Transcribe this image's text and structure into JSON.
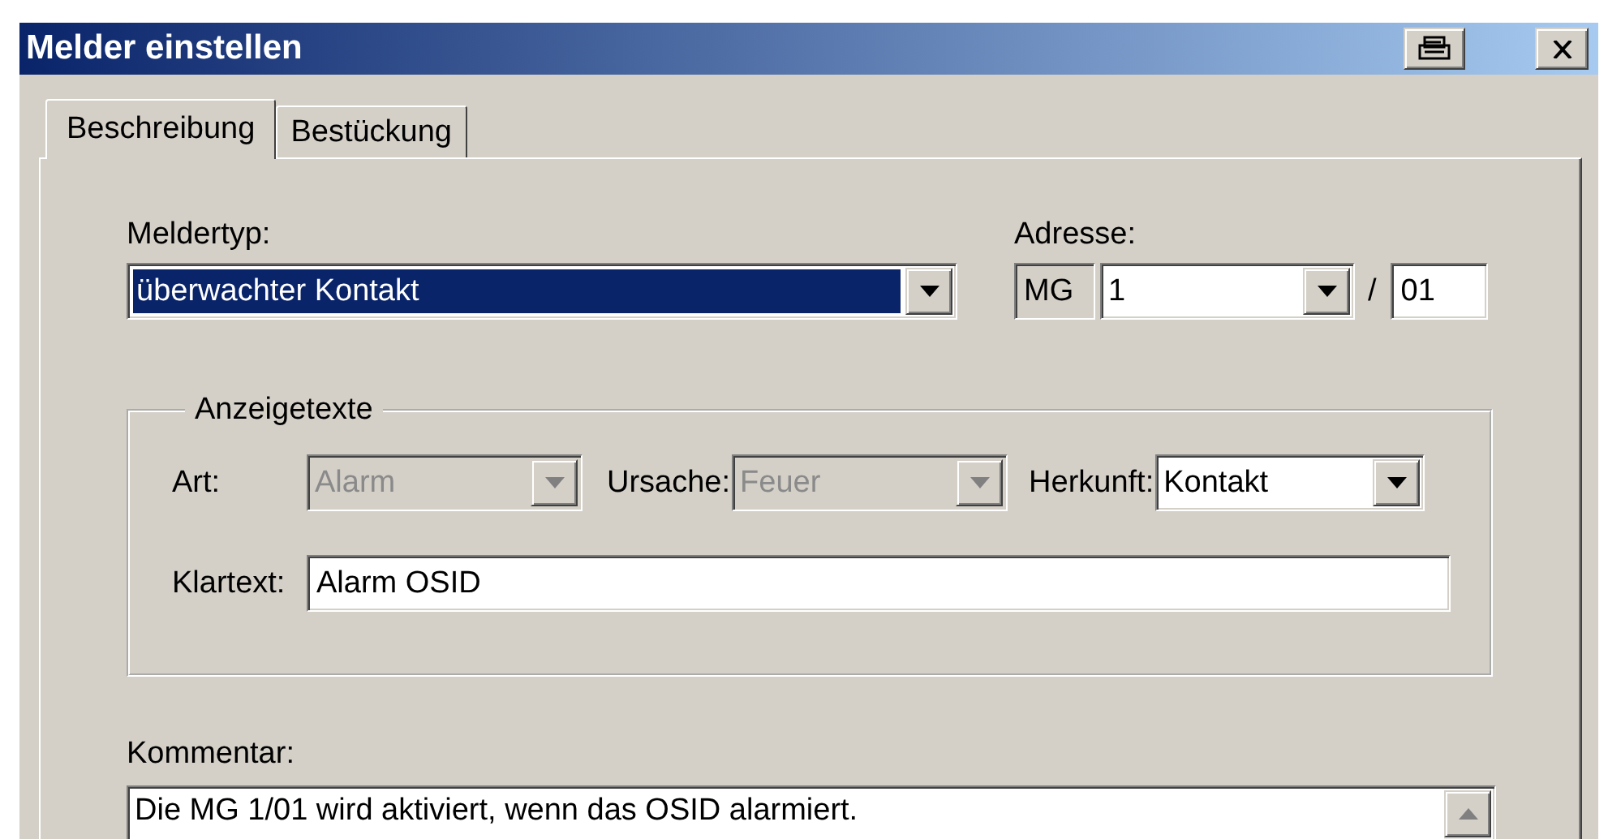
{
  "window": {
    "title": "Melder einstellen"
  },
  "tabs": [
    {
      "label": "Beschreibung",
      "selected": true
    },
    {
      "label": "Bestückung",
      "selected": false
    }
  ],
  "meldertyp": {
    "label": "Meldertyp:",
    "value": "überwachter Kontakt",
    "highlighted": true
  },
  "adresse": {
    "label": "Adresse:",
    "prefix": "MG",
    "group": "1",
    "separator": "/",
    "number": "01"
  },
  "anzeigetexte": {
    "title": "Anzeigetexte",
    "fields": [
      {
        "label": "Art:",
        "value": "Alarm",
        "disabled": true
      },
      {
        "label": "Ursache:",
        "value": "Feuer",
        "disabled": true
      },
      {
        "label": "Herkunft:",
        "value": "Kontakt",
        "disabled": false
      }
    ],
    "klartext": {
      "label": "Klartext:",
      "value": "Alarm OSID"
    }
  },
  "kommentar": {
    "label": "Kommentar:",
    "value": "Die MG 1/01 wird aktiviert, wenn das OSID alarmiert."
  }
}
